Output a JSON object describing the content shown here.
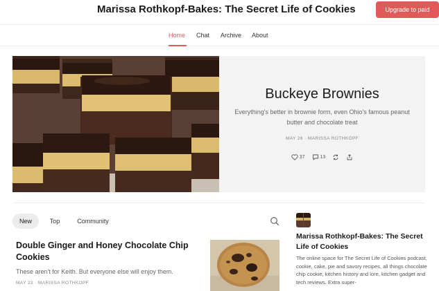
{
  "header": {
    "title": "Marissa Rothkopf-Bakes: The Secret Life of Cookies",
    "upgrade_label": "Upgrade to paid"
  },
  "nav": {
    "items": [
      "Home",
      "Chat",
      "Archive",
      "About"
    ],
    "active": "Home"
  },
  "featured": {
    "title": "Buckeye Brownies",
    "subtitle": "Everything's better in brownie form, even Ohio's famous peanut butter and chocolate treat",
    "meta": "MAY 26 · MARISSA ROTHKOPF",
    "likes": "37",
    "comments": "13",
    "image_icon": "brownie-photo"
  },
  "feed_tabs": {
    "items": [
      "New",
      "Top",
      "Community"
    ],
    "active": "New"
  },
  "post": {
    "title": "Double Ginger and Honey Chocolate Chip Cookies",
    "subtitle": "These aren't for Keith. But everyone else will enjoy them.",
    "meta": "MAY 23 · MARISSA ROTHKOPF",
    "image_icon": "cookie-photo"
  },
  "sidebar": {
    "title": "Marissa Rothkopf-Bakes: The Secret Life of Cookies",
    "description": "The online space for The Secret Life of Cookies podcast, cookie, cake, pie and savory recipes, all things chocolate chip cookie, kitchen history and lore, kitchen gadget and tech reviews. Extra super-"
  },
  "colors": {
    "accent": "#e05a59",
    "hero_panel": "#f3f3f3",
    "pill": "#ececec"
  }
}
